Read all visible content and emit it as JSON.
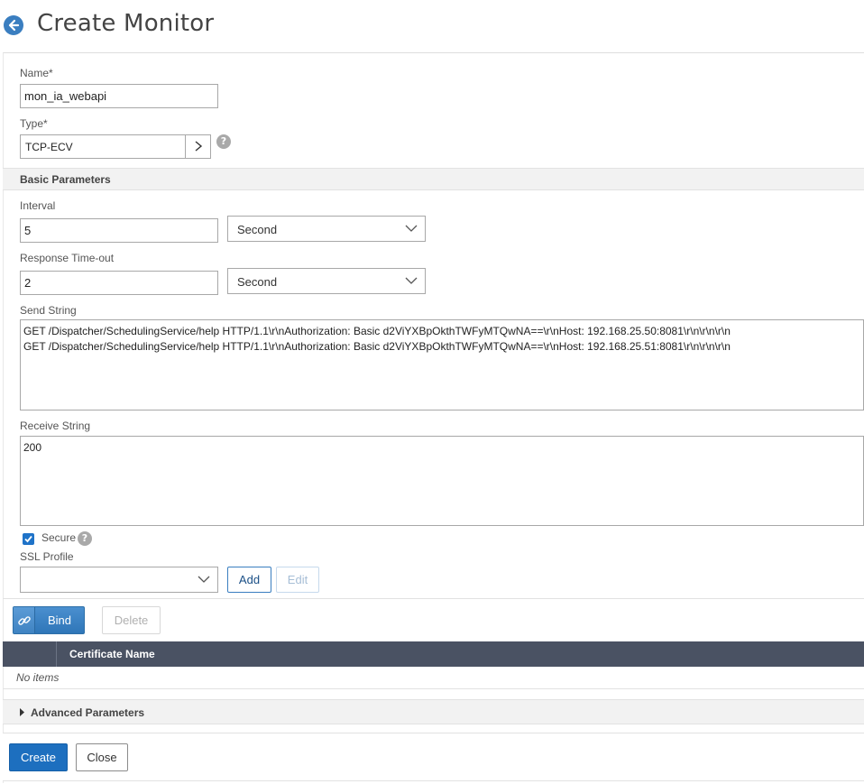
{
  "header": {
    "title": "Create Monitor",
    "back_icon": "back-arrow-icon"
  },
  "form": {
    "name": {
      "label": "Name*",
      "value": "mon_ia_webapi"
    },
    "type": {
      "label": "Type*",
      "value": "TCP-ECV",
      "help_glyph": "?"
    }
  },
  "basic_parameters": {
    "title": "Basic Parameters",
    "interval": {
      "label": "Interval",
      "value": "5",
      "unit": "Second"
    },
    "response_timeout": {
      "label": "Response Time-out",
      "value": "2",
      "unit": "Second"
    },
    "send_string": {
      "label": "Send String",
      "lines": [
        "GET /Dispatcher/SchedulingService/help HTTP/1.1\\r\\nAuthorization: Basic d2ViYXBpOkthTWFyMTQwNA==\\r\\nHost: 192.168.25.50:8081\\r\\n\\r\\n\\r\\n",
        "GET /Dispatcher/SchedulingService/help HTTP/1.1\\r\\nAuthorization: Basic d2ViYXBpOkthTWFyMTQwNA==\\r\\nHost: 192.168.25.51:8081\\r\\n\\r\\n\\r\\n"
      ]
    },
    "receive_string": {
      "label": "Receive String",
      "value": "200"
    },
    "secure": {
      "label": "Secure",
      "checked": true,
      "help_glyph": "?"
    },
    "ssl_profile": {
      "label": "SSL Profile",
      "value": "",
      "add_label": "Add",
      "edit_label": "Edit"
    }
  },
  "certificates": {
    "bind_label": "Bind",
    "delete_label": "Delete",
    "column_header": "Certificate Name",
    "empty_text": "No items"
  },
  "advanced": {
    "title": "Advanced Parameters"
  },
  "footer": {
    "create_label": "Create",
    "close_label": "Close"
  },
  "colors": {
    "primary": "#1d6fbf",
    "table_header": "#4a5263",
    "section_bg": "#f2f2f2"
  }
}
